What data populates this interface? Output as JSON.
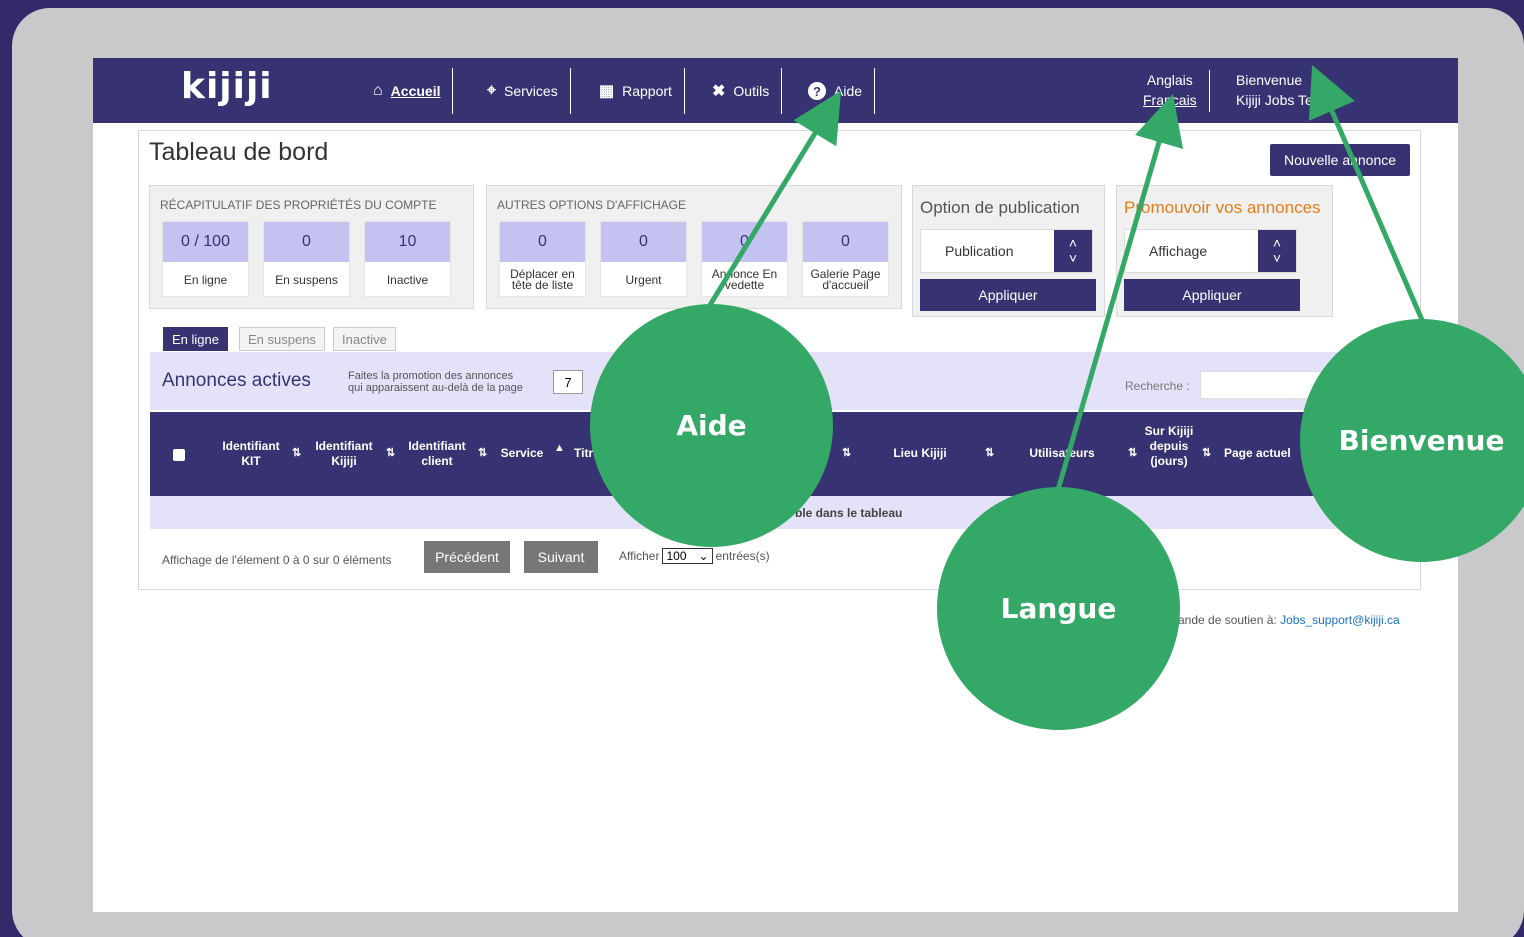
{
  "nav": {
    "logo": "kijiji",
    "items": [
      {
        "label": "Accueil",
        "icon": "home-icon"
      },
      {
        "label": "Services",
        "icon": "location-pin-icon"
      },
      {
        "label": "Rapport",
        "icon": "report-icon"
      },
      {
        "label": "Outils",
        "icon": "tools-icon"
      },
      {
        "label": "Aide",
        "icon": "help-icon"
      }
    ],
    "lang_en": "Anglais",
    "lang_fr": "Francais",
    "welcome_line1": "Bienvenue",
    "welcome_line2": "Kijiji Jobs Te"
  },
  "dashboard": {
    "title": "Tableau de bord",
    "new_ad": "Nouvelle annonce",
    "account_box_title": "RÉCAPITULATIF DES PROPRIÉTÉS DU COMPTE",
    "account_stats": [
      {
        "value": "0 / 100",
        "label": "En ligne"
      },
      {
        "value": "0",
        "label": "En suspens"
      },
      {
        "value": "10",
        "label": "Inactive"
      }
    ],
    "display_box_title": "AUTRES OPTIONS D'AFFICHAGE",
    "display_stats": [
      {
        "value": "0",
        "label": "Déplacer en tête de liste"
      },
      {
        "value": "0",
        "label": "Urgent"
      },
      {
        "value": "0",
        "label": "Annonce En vedette"
      },
      {
        "value": "0",
        "label": "Galerie Page d'accueil"
      }
    ],
    "publication": {
      "title": "Option de publication",
      "selected": "Publication",
      "apply": "Appliquer"
    },
    "promote": {
      "title": "Promouvoir vos annonces",
      "selected": "Affichage",
      "apply": "Appliquer"
    }
  },
  "tabs": [
    "En ligne",
    "En suspens",
    "Inactive"
  ],
  "list": {
    "title": "Annonces actives",
    "promo_text_1": "Faites la promotion des annonces",
    "promo_text_2": "qui apparaissent au-delà de la page",
    "promo_page": "7",
    "search_label": "Recherche :",
    "columns": [
      "Identifiant KIT",
      "Identifiant Kijiji",
      "Identifiant client",
      "Service",
      "Titre",
      "Lieu Kijiji",
      "Utilisateurs",
      "Sur Kijiji depuis (jours)",
      "Page actuel"
    ],
    "empty_message": "Aucune donnée disponible dans le tableau",
    "empty_visible": "ble dans le tableau",
    "info": "Affichage de l'élement 0 à 0 sur 0 éléments",
    "prev": "Précédent",
    "next": "Suivant",
    "show_label": "Afficher",
    "show_value": "100",
    "entries_label": "entrées(s)"
  },
  "support_text": "ande de soutien à: ",
  "support_email": "Jobs_support@kijiji.ca",
  "callouts": {
    "aide": "Aide",
    "langue": "Langue",
    "bienvenue": "Bienvenue",
    "color": "#33a867"
  }
}
